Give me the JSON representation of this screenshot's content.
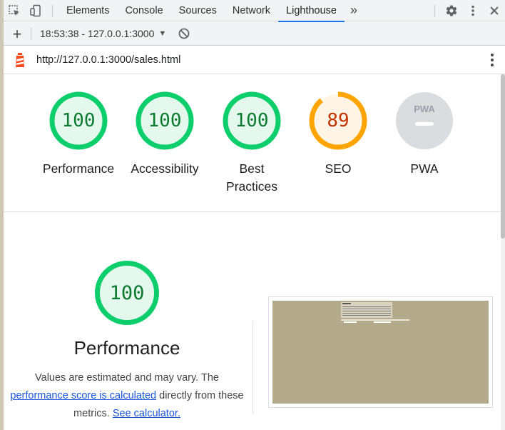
{
  "devtools": {
    "tabs": [
      {
        "label": "Elements"
      },
      {
        "label": "Console"
      },
      {
        "label": "Sources"
      },
      {
        "label": "Network"
      },
      {
        "label": "Lighthouse",
        "active": true
      }
    ],
    "more_tabs": "»"
  },
  "report_toolbar": {
    "report_label": "18:53:38 - 127.0.0.1:3000"
  },
  "url_bar": {
    "url": "http://127.0.0.1:3000/sales.html"
  },
  "gauges": [
    {
      "label": "Performance",
      "score": "100",
      "color": "#0cce6b",
      "text_color": "#0a7b2e",
      "fill": "#e5f8ee",
      "fraction": 1.0
    },
    {
      "label": "Accessibility",
      "score": "100",
      "color": "#0cce6b",
      "text_color": "#0a7b2e",
      "fill": "#e5f8ee",
      "fraction": 1.0
    },
    {
      "label": "Best\nPractices",
      "score": "100",
      "color": "#0cce6b",
      "text_color": "#0a7b2e",
      "fill": "#e5f8ee",
      "fraction": 1.0
    },
    {
      "label": "SEO",
      "score": "89",
      "color": "#ffa400",
      "text_color": "#c33300",
      "fill": "#fff4e5",
      "fraction": 0.89
    },
    {
      "label": "PWA",
      "badge": "PWA",
      "color": "#dadce0"
    }
  ],
  "performance": {
    "score": "100",
    "title": "Performance",
    "desc_1": "Values are estimated and may vary. The",
    "link_1": "performance score is calculated",
    "desc_2": " directly from these",
    "desc_3": "metrics. ",
    "link_2": "See calculator."
  },
  "icons": {
    "inspect": "inspect-element-icon",
    "device": "device-toolbar-icon",
    "settings": "gear-icon",
    "menu": "kebab-menu-icon",
    "close": "close-icon",
    "new_report": "plus-icon",
    "clear": "block-icon",
    "lighthouse": "lighthouse-logo-icon"
  }
}
